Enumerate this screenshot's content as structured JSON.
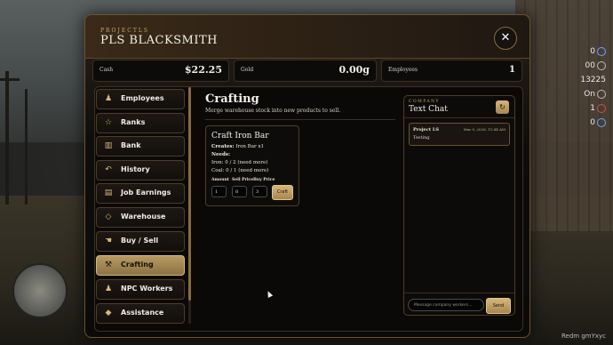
{
  "panel": {
    "subtitle": "PROJECTLS",
    "title": "PLS BLACKSMITH",
    "close_label": "✕"
  },
  "stats": {
    "cash": {
      "label": "Cash",
      "value": "$22.25"
    },
    "gold": {
      "label": "Gold",
      "value": "0.00g"
    },
    "employees": {
      "label": "Employees",
      "value": "1"
    }
  },
  "sidebar": {
    "items": [
      {
        "label": "Employees",
        "icon": "person-icon",
        "glyph": "♟"
      },
      {
        "label": "Ranks",
        "icon": "star-icon",
        "glyph": "☆"
      },
      {
        "label": "Bank",
        "icon": "bank-icon",
        "glyph": "▥"
      },
      {
        "label": "History",
        "icon": "history-icon",
        "glyph": "↶"
      },
      {
        "label": "Job Earnings",
        "icon": "ledger-icon",
        "glyph": "▤"
      },
      {
        "label": "Warehouse",
        "icon": "warehouse-icon",
        "glyph": "◇"
      },
      {
        "label": "Buy / Sell",
        "icon": "hand-icon",
        "glyph": "☚"
      },
      {
        "label": "Crafting",
        "icon": "hammer-icon",
        "glyph": "⚒"
      },
      {
        "label": "NPC Workers",
        "icon": "worker-icon",
        "glyph": "♟"
      },
      {
        "label": "Assistance",
        "icon": "diamond-icon",
        "glyph": "◆"
      }
    ],
    "active_index": 7
  },
  "content": {
    "title": "Crafting",
    "description": "Merge warehouse stock into new products to sell."
  },
  "recipe": {
    "title": "Craft Iron Bar",
    "creates_label": "Creates:",
    "creates_value": "Iron Bar x1",
    "needs_label": "Needs:",
    "needs": [
      "Iron: 0 / 2 (need more)",
      "Coal: 0 / 1 (need more)"
    ],
    "amount_label": "Amount",
    "sell_price_label": "Sell Price",
    "buy_price_label": "Buy Price",
    "amount_value": "1",
    "sell_price_value": "8",
    "buy_price_value": "3",
    "craft_label": "Craft"
  },
  "chat": {
    "subtitle": "COMPANY",
    "title": "Text Chat",
    "refresh_glyph": "↻",
    "messages": [
      {
        "author": "Project LS",
        "time": "Mar 9, 2026, 11:44 AM",
        "text": "Testing"
      }
    ],
    "input_placeholder": "Message company workers...",
    "send_label": "Send"
  },
  "hud": {
    "rows": [
      "0",
      "0",
      "0",
      "00",
      "132",
      "25",
      "On",
      "1",
      "0"
    ]
  },
  "watermark": "Redm gmYxyc"
}
